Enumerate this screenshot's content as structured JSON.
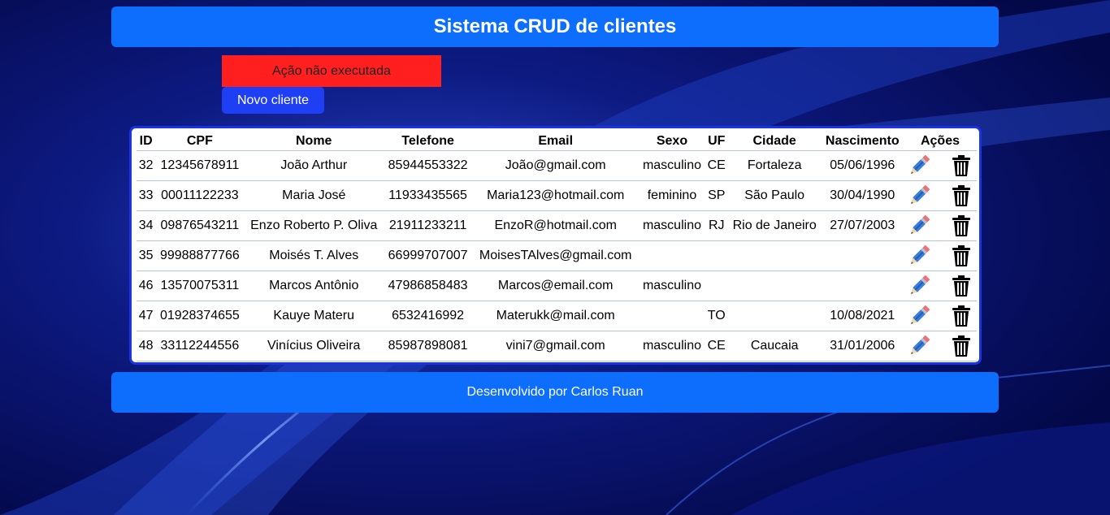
{
  "header": {
    "title": "Sistema CRUD de clientes"
  },
  "alert": {
    "message": "Ação não executada",
    "color": "#ff1f1f"
  },
  "actions": {
    "new_client_label": "Novo cliente"
  },
  "table": {
    "columns": [
      "ID",
      "CPF",
      "Nome",
      "Telefone",
      "Email",
      "Sexo",
      "UF",
      "Cidade",
      "Nascimento",
      "Ações"
    ],
    "rows": [
      {
        "id": "32",
        "cpf": "12345678911",
        "nome": "João Arthur",
        "telefone": "85944553322",
        "email": "João@gmail.com",
        "sexo": "masculino",
        "uf": "CE",
        "cidade": "Fortaleza",
        "nascimento": "05/06/1996"
      },
      {
        "id": "33",
        "cpf": "00011122233",
        "nome": "Maria José",
        "telefone": "11933435565",
        "email": "Maria123@hotmail.com",
        "sexo": "feminino",
        "uf": "SP",
        "cidade": "São Paulo",
        "nascimento": "30/04/1990"
      },
      {
        "id": "34",
        "cpf": "09876543211",
        "nome": "Enzo Roberto P. Oliva",
        "telefone": "21911233211",
        "email": "EnzoR@hotmail.com",
        "sexo": "masculino",
        "uf": "RJ",
        "cidade": "Rio de Janeiro",
        "nascimento": "27/07/2003"
      },
      {
        "id": "35",
        "cpf": "99988877766",
        "nome": "Moisés T. Alves",
        "telefone": "66999707007",
        "email": "MoisesTAlves@gmail.com",
        "sexo": "",
        "uf": "",
        "cidade": "",
        "nascimento": ""
      },
      {
        "id": "46",
        "cpf": "13570075311",
        "nome": "Marcos Antônio",
        "telefone": "47986858483",
        "email": "Marcos@email.com",
        "sexo": "masculino",
        "uf": "",
        "cidade": "",
        "nascimento": ""
      },
      {
        "id": "47",
        "cpf": "01928374655",
        "nome": "Kauye Materu",
        "telefone": "6532416992",
        "email": "Materukk@mail.com",
        "sexo": "",
        "uf": "TO",
        "cidade": "",
        "nascimento": "10/08/2021"
      },
      {
        "id": "48",
        "cpf": "33112244556",
        "nome": "Vinícius Oliveira",
        "telefone": "85987898081",
        "email": "vini7@gmail.com",
        "sexo": "masculino",
        "uf": "CE",
        "cidade": "Caucaia",
        "nascimento": "31/01/2006"
      }
    ],
    "row_icons": [
      "pencil-icon",
      "trash-icon"
    ]
  },
  "footer": {
    "text": "Desenvolvido por Carlos Ruan"
  },
  "colors": {
    "accent": "#0d6efd",
    "button": "#1f3ff5",
    "table_border": "#1a35e0",
    "background": "#040a4a"
  }
}
